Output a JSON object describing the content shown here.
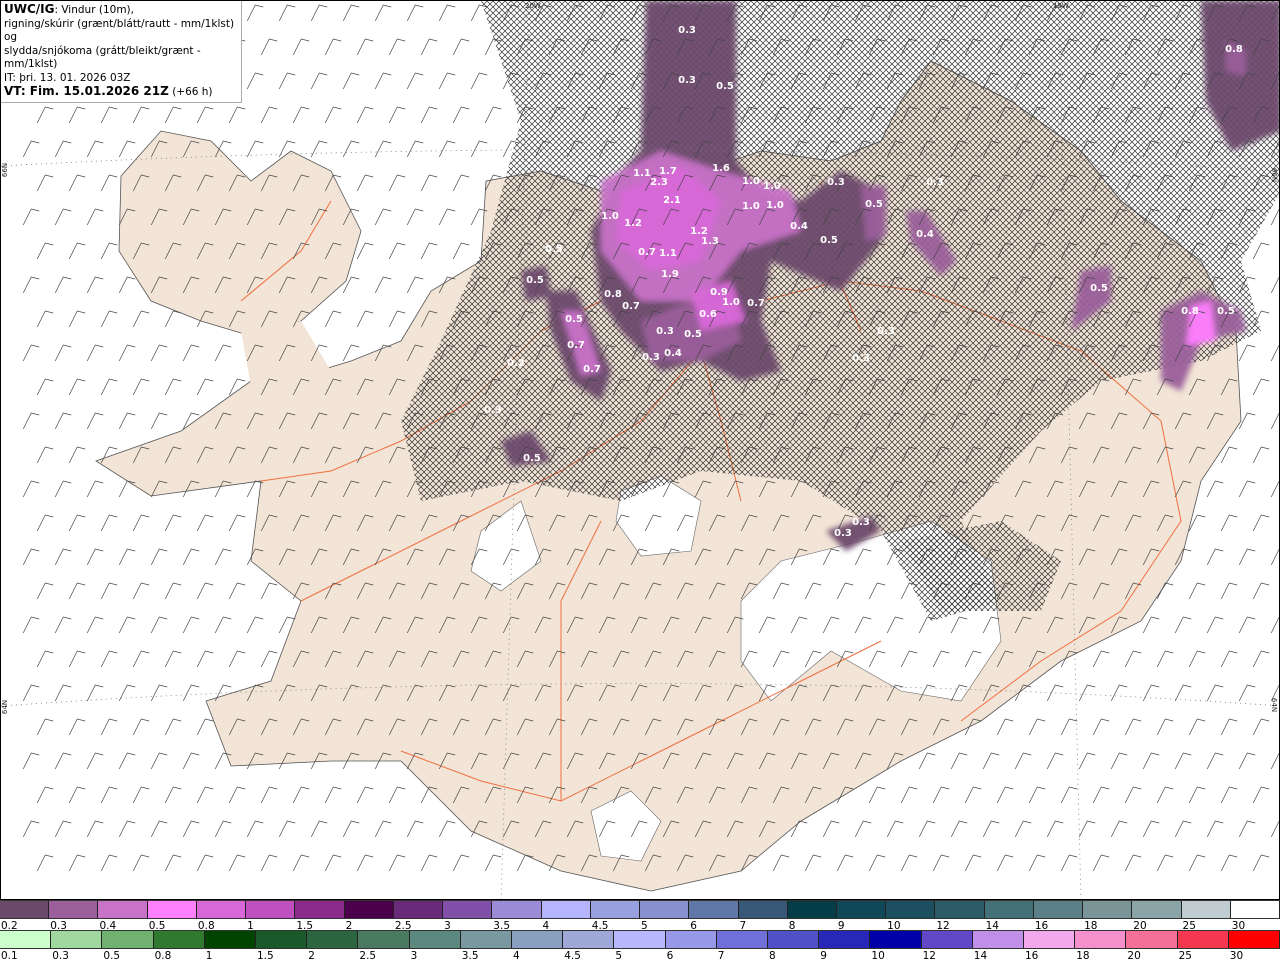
{
  "header": {
    "model": "UWC/IG",
    "line1": ": Vindur (10m),",
    "line2": "rigning/skúrir (grænt/blátt/rautt - mm/1klst) og",
    "line3": "slydda/snjókoma (grátt/bleikt/grænt - mm/1klst)",
    "it": "IT: þri. 13. 01. 2026 03Z",
    "vt_bold": "VT: Fim. 15.01.2026 21Z",
    "vt_lead": "(+66 h)"
  },
  "graticule": {
    "lon_20w": "20W",
    "lon_15w": "15W",
    "lat_66n_left": "66N",
    "lat_66n_right": "66N",
    "lat_64n_left": "64N",
    "lat_64n_right": "64N"
  },
  "colors": {
    "land": "#f2e4d6",
    "sea": "#ffffff",
    "roads": "#f07040",
    "glacier": "#ffffff"
  },
  "precip_labels": [
    "0.3",
    "0.3",
    "0.5",
    "0.3",
    "1.1",
    "1.7",
    "2.3",
    "2.1",
    "1.6",
    "1.0",
    "1.0",
    "1.0",
    "1.0",
    "0.3",
    "1.0",
    "1.2",
    "1.2",
    "1.3",
    "0.7",
    "1.1",
    "1.9",
    "0.8",
    "0.5",
    "0.5",
    "0.5",
    "0.7",
    "0.9",
    "1.0",
    "0.7",
    "0.6",
    "0.5",
    "0.3",
    "0.4",
    "0.3",
    "0.5",
    "0.7",
    "0.7",
    "0.3",
    "0.8",
    "0.4",
    "0.5",
    "0.5",
    "0.4",
    "0.5",
    "0.8",
    "0.5",
    "0.3",
    "0.3",
    "0.3",
    "0.3",
    "0.2"
  ],
  "legend_snow": {
    "labels": [
      "0.2",
      "0.3",
      "0.4",
      "0.5",
      "0.8",
      "1",
      "1.5",
      "2",
      "2.5",
      "3",
      "3.5",
      "4",
      "4.5",
      "5",
      "6",
      "7",
      "8",
      "9",
      "10",
      "12",
      "14",
      "16",
      "18",
      "20",
      "25",
      "30"
    ],
    "colors": [
      "#6b4a6b",
      "#9b5f9b",
      "#c873c8",
      "#ff80ff",
      "#d868d8",
      "#c050c0",
      "#8a2a8a",
      "#4a004a",
      "#6a2a7a",
      "#8050a8",
      "#9c8cd8",
      "#b4b4ff",
      "#98a0e0",
      "#8890d0",
      "#6078a8",
      "#385878",
      "#043c48",
      "#104858",
      "#1c5060",
      "#2c5c68",
      "#447078",
      "#5c8088",
      "#7a9498",
      "#8aa4a8",
      "#c0ccd0",
      "#ffffff"
    ]
  },
  "legend_rain": {
    "labels": [
      "0.1",
      "0.3",
      "0.5",
      "0.8",
      "1",
      "1.5",
      "2",
      "2.5",
      "3",
      "3.5",
      "4",
      "4.5",
      "5",
      "6",
      "7",
      "8",
      "9",
      "10",
      "12",
      "14",
      "16",
      "18",
      "20",
      "25",
      "30"
    ],
    "colors": [
      "#ccffcc",
      "#a0d8a0",
      "#70b070",
      "#307a30",
      "#004400",
      "#1a5a2a",
      "#2c6640",
      "#4a7a60",
      "#5c8880",
      "#7a98a0",
      "#8aa0c0",
      "#a0a8d8",
      "#b8b8ff",
      "#9898e8",
      "#7070d8",
      "#5050c8",
      "#2828b8",
      "#0000a8",
      "#6048c8",
      "#c090e8",
      "#f4a8ec",
      "#f490cc",
      "#f47098",
      "#f43850",
      "#ff0000"
    ]
  }
}
